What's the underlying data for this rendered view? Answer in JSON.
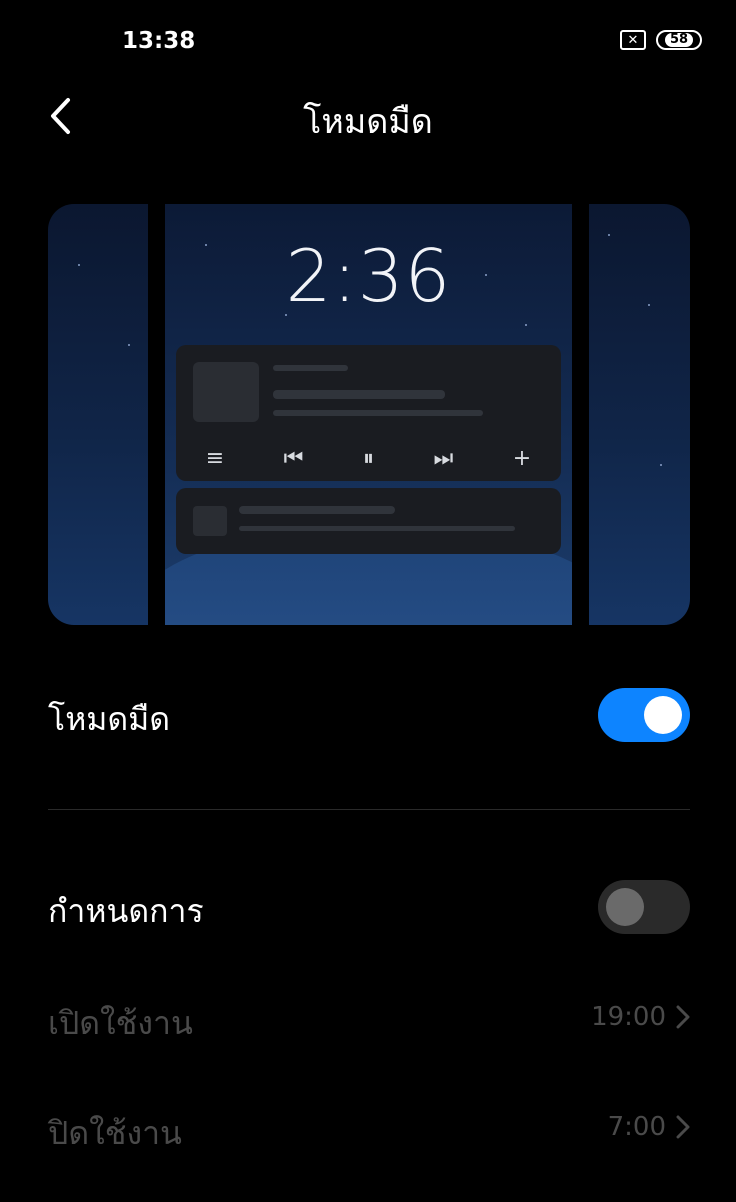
{
  "status_bar": {
    "time": "13:38",
    "sim_icon": "x-box-icon",
    "battery": "58"
  },
  "header": {
    "title": "โหมดมืด",
    "back_icon": "chevron-left-icon"
  },
  "preview": {
    "clock": "2:36",
    "media_controls": [
      "list-icon",
      "previous-icon",
      "pause-icon",
      "next-icon",
      "plus-icon"
    ]
  },
  "settings": {
    "dark_mode": {
      "label": "โหมดมืด",
      "enabled": true
    },
    "schedule": {
      "label": "กำหนดการ",
      "enabled": false
    },
    "turn_on": {
      "label": "เปิดใช้งาน",
      "value": "19:00"
    },
    "turn_off": {
      "label": "ปิดใช้งาน",
      "value": "7:00"
    }
  },
  "colors": {
    "accent": "#0d84ff",
    "background": "#000000",
    "disabled_text": "#4a4a4a"
  }
}
